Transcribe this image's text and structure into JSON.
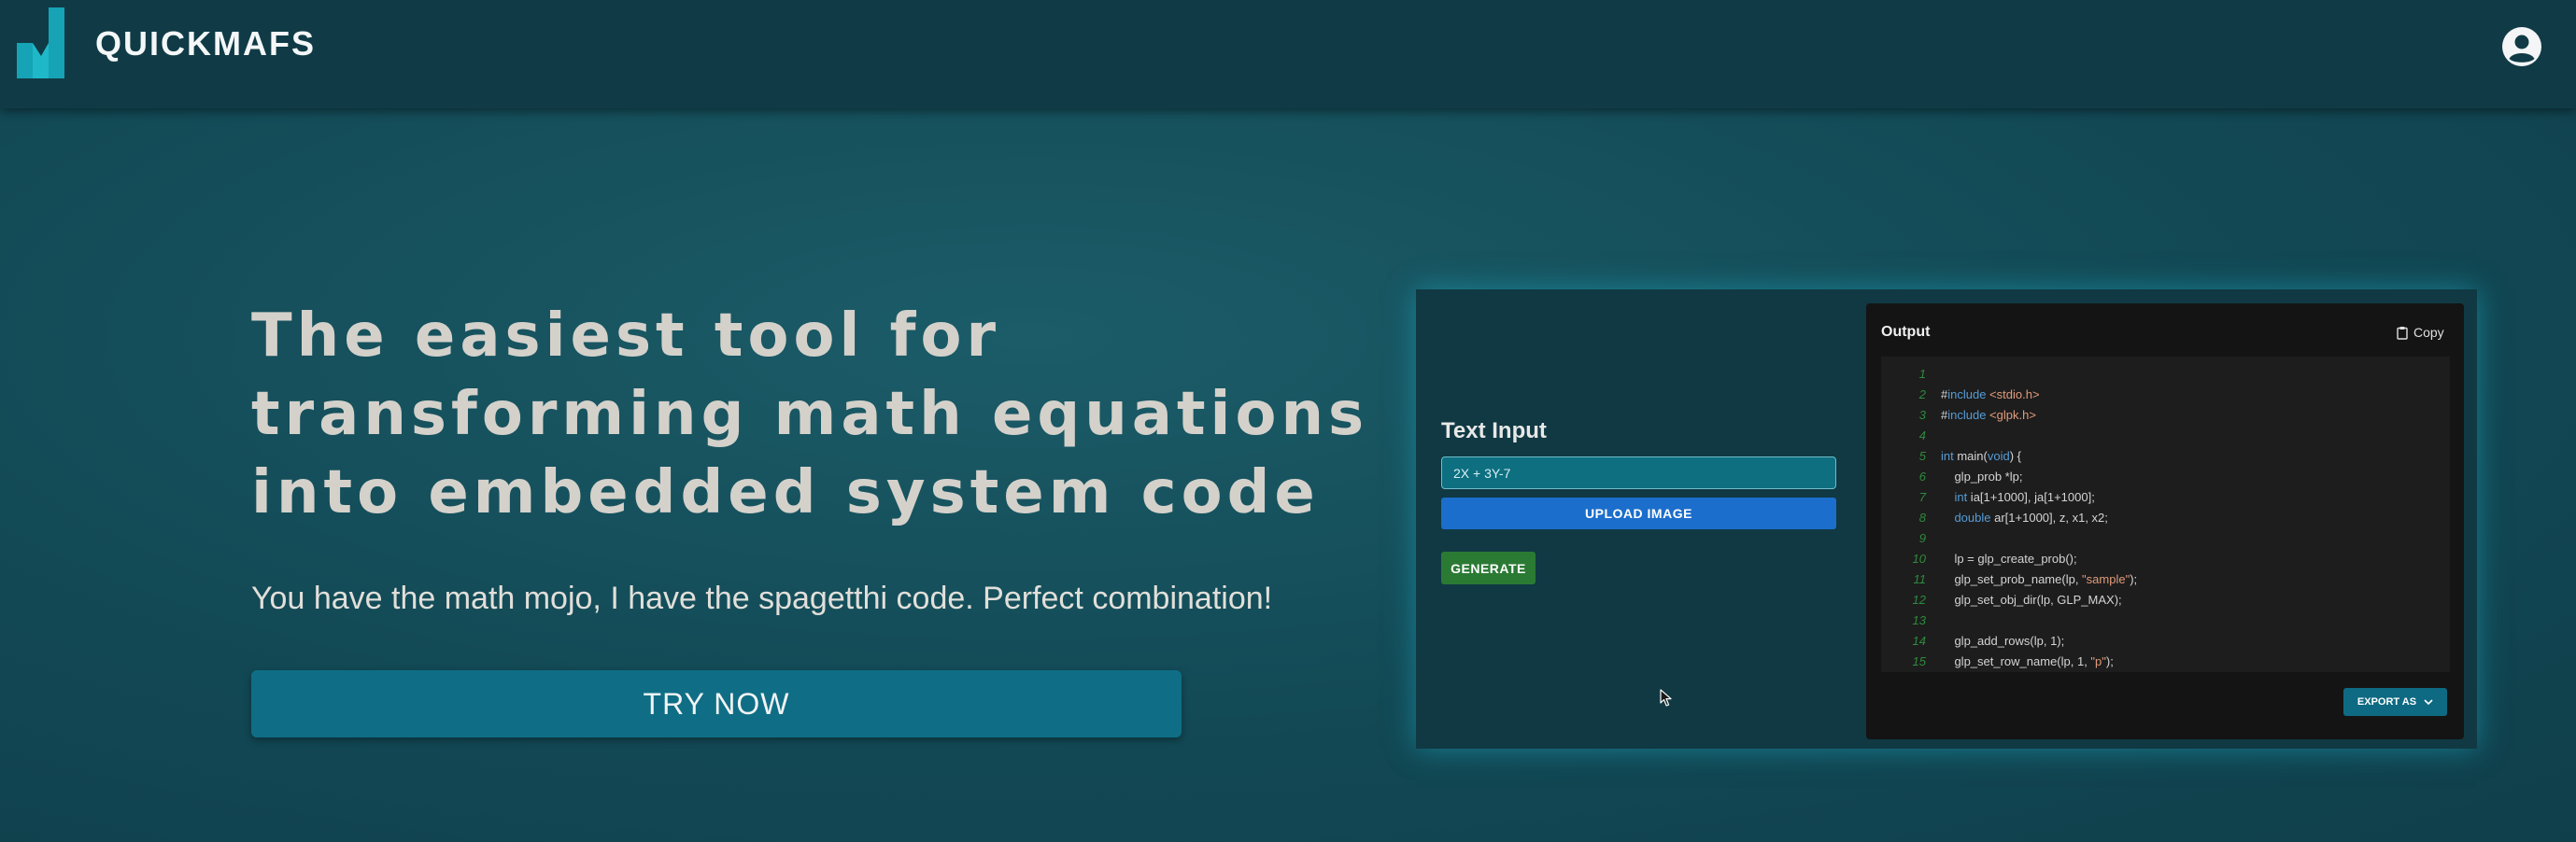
{
  "navbar": {
    "logo_text": "QUICKMAFS",
    "account_icon": "account-circle-icon"
  },
  "hero": {
    "title_lines": [
      "The easiest tool for",
      "transforming math equations",
      "into embedded system code"
    ],
    "subtitle": "You have the math mojo, I have the spagetthi code. Perfect combination!",
    "cta_label": "TRY NOW"
  },
  "demo": {
    "input_heading": "Text Input",
    "input_value": "2X + 3Y-7",
    "upload_label": "UPLOAD IMAGE",
    "generate_label": "GENERATE",
    "output": {
      "heading": "Output",
      "copy_label": "Copy",
      "copy_icon": "clipboard-icon",
      "export_label": "EXPORT AS",
      "export_icon": "chevron-down-icon",
      "code_lines": [
        {
          "n": "1",
          "tokens": []
        },
        {
          "n": "2",
          "tokens": [
            {
              "t": "#",
              "c": "txt"
            },
            {
              "t": "include",
              "c": "kw"
            },
            {
              "t": " <stdio.h>",
              "c": "str"
            }
          ]
        },
        {
          "n": "3",
          "tokens": [
            {
              "t": "#",
              "c": "txt"
            },
            {
              "t": "include",
              "c": "kw"
            },
            {
              "t": " <glpk.h>",
              "c": "str"
            }
          ]
        },
        {
          "n": "4",
          "tokens": []
        },
        {
          "n": "5",
          "tokens": [
            {
              "t": "int",
              "c": "kw"
            },
            {
              "t": " main(",
              "c": "txt"
            },
            {
              "t": "void",
              "c": "kw"
            },
            {
              "t": ") {",
              "c": "txt"
            }
          ]
        },
        {
          "n": "6",
          "tokens": [
            {
              "t": "    glp_prob *lp;",
              "c": "txt"
            }
          ]
        },
        {
          "n": "7",
          "tokens": [
            {
              "t": "    ",
              "c": "txt"
            },
            {
              "t": "int",
              "c": "kw"
            },
            {
              "t": " ia[1+1000], ja[1+1000];",
              "c": "txt"
            }
          ]
        },
        {
          "n": "8",
          "tokens": [
            {
              "t": "    ",
              "c": "txt"
            },
            {
              "t": "double",
              "c": "kw"
            },
            {
              "t": " ar[1+1000], z, x1, x2;",
              "c": "txt"
            }
          ]
        },
        {
          "n": "9",
          "tokens": []
        },
        {
          "n": "10",
          "tokens": [
            {
              "t": "    lp = glp_create_prob();",
              "c": "txt"
            }
          ]
        },
        {
          "n": "11",
          "tokens": [
            {
              "t": "    glp_set_prob_name(lp, ",
              "c": "txt"
            },
            {
              "t": "\"sample\"",
              "c": "str"
            },
            {
              "t": ");",
              "c": "txt"
            }
          ]
        },
        {
          "n": "12",
          "tokens": [
            {
              "t": "    glp_set_obj_dir(lp, GLP_MAX);",
              "c": "txt"
            }
          ]
        },
        {
          "n": "13",
          "tokens": []
        },
        {
          "n": "14",
          "tokens": [
            {
              "t": "    glp_add_rows(lp, 1);",
              "c": "txt"
            }
          ]
        },
        {
          "n": "15",
          "tokens": [
            {
              "t": "    glp_set_row_name(lp, 1, ",
              "c": "txt"
            },
            {
              "t": "\"p\"",
              "c": "str"
            },
            {
              "t": ");",
              "c": "txt"
            }
          ]
        }
      ]
    }
  },
  "colors": {
    "background": "#124955",
    "navbar": "#103b46",
    "brand_teal": "#15a3b5",
    "cta": "#0f6e86",
    "upload": "#1b6ecb",
    "generate": "#2b7a34",
    "code_keyword": "#569cd6",
    "code_string": "#e09b7b",
    "line_number": "#2e8b3e"
  }
}
